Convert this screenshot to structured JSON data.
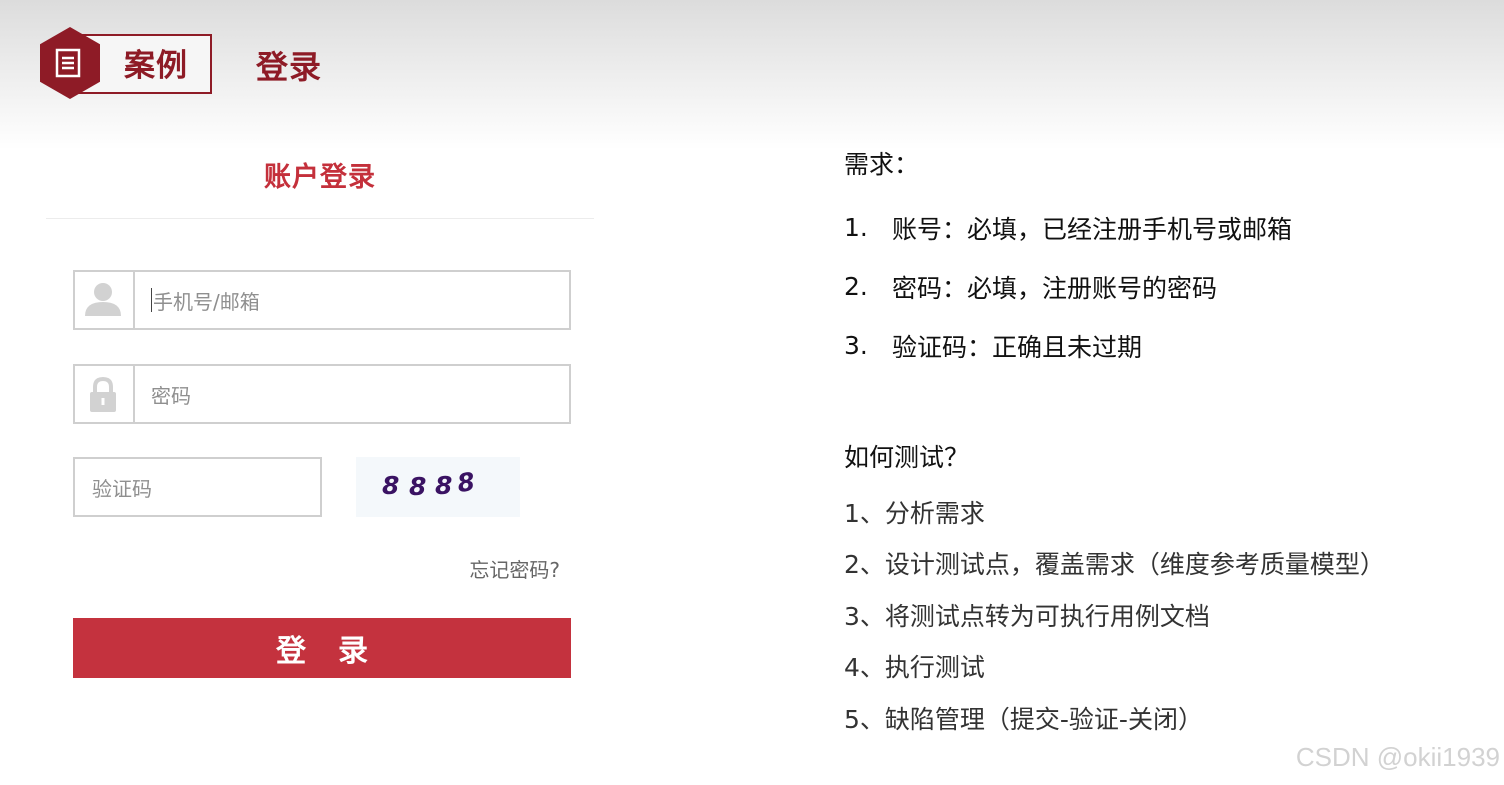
{
  "header": {
    "badge_icon": "document-icon",
    "badge_label": "案例",
    "title": "登录",
    "brand_color": "#8e1b26"
  },
  "login_panel": {
    "title": "账户登录",
    "account_field": {
      "icon": "user-icon",
      "placeholder": "手机号/邮箱"
    },
    "password_field": {
      "icon": "lock-icon",
      "placeholder": "密码"
    },
    "captcha_field": {
      "placeholder": "验证码"
    },
    "captcha_image_text": "8888",
    "forgot_link": "忘记密码?",
    "login_button": "登录",
    "accent_color": "#c4323e"
  },
  "requirements": {
    "heading": "需求：",
    "items": [
      {
        "num": "1.",
        "text": "账号：必填，已经注册手机号或邮箱"
      },
      {
        "num": "2.",
        "text": "密码：必填，注册账号的密码"
      },
      {
        "num": "3.",
        "text": "验证码：正确且未过期"
      }
    ]
  },
  "how_to_test": {
    "heading": "如何测试？",
    "steps": [
      "1、分析需求",
      "2、设计测试点，覆盖需求（维度参考质量模型）",
      "3、将测试点转为可执行用例文档",
      "4、执行测试",
      "5、缺陷管理（提交-验证-关闭）"
    ]
  },
  "watermark": "CSDN @okii1939"
}
